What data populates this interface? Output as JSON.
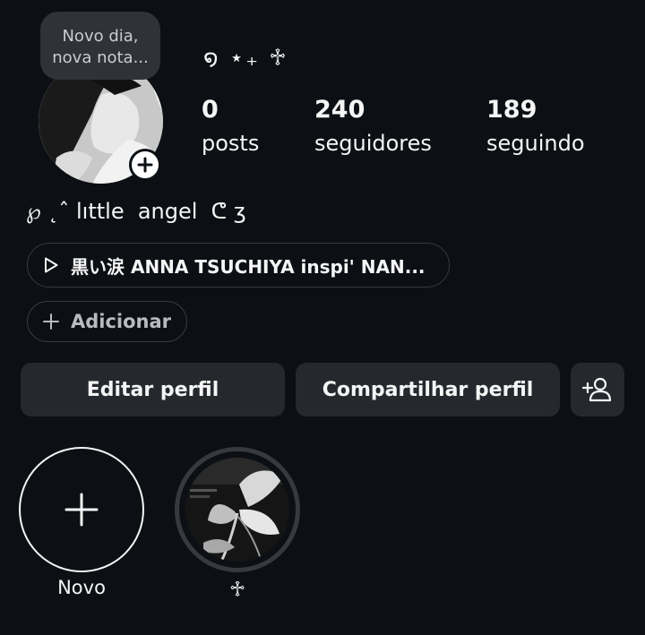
{
  "note": {
    "text": "Novo dia,\nnova nota..."
  },
  "profile": {
    "username": "໑ ⋆₊ ♱",
    "display_name": "℘ ˛ˆ lıttle  angel  ᕦ ʒ"
  },
  "stats": {
    "posts": {
      "value": "0",
      "label": "posts"
    },
    "followers": {
      "value": "240",
      "label": "seguidores"
    },
    "following": {
      "value": "189",
      "label": "seguindo"
    }
  },
  "music": {
    "text": "黒い涙 ANNA TSUCHIYA inspi' NAN..."
  },
  "add_link": {
    "label": "Adicionar"
  },
  "buttons": {
    "edit": "Editar perfil",
    "share": "Compartilhar perfil"
  },
  "highlights": [
    {
      "label": "Novo",
      "icon": "plus-icon"
    },
    {
      "label": "♱",
      "icon": "highlight-cover"
    }
  ],
  "colors": {
    "background": "#0c1014",
    "button": "#25292e",
    "note_bubble": "#2f3338",
    "pill_border": "#363a3f"
  }
}
